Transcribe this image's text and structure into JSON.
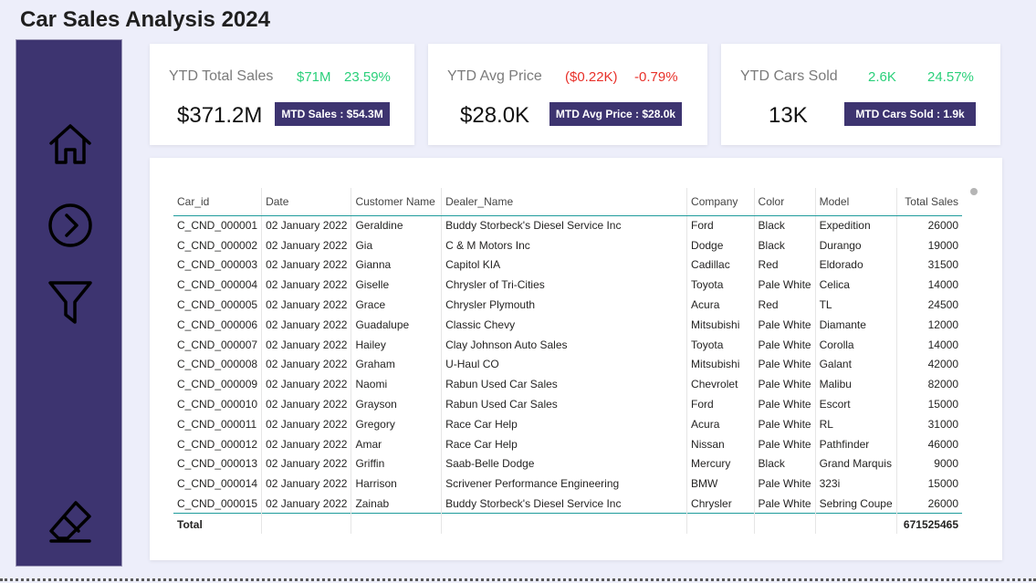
{
  "page": {
    "title": "Car Sales Analysis 2024"
  },
  "sidebar": {
    "icons": [
      "home-icon",
      "chevron-right-circle-icon",
      "filter-icon",
      "eraser-icon"
    ]
  },
  "kpis": [
    {
      "label": "YTD Total Sales",
      "delta1": "$71M",
      "delta2": "23.59%",
      "value": "$371.2M",
      "badge": "MTD Sales : $54.3M",
      "delta_color": "#2ad07a"
    },
    {
      "label": "YTD Avg Price",
      "delta1": "($0.22K)",
      "delta2": "-0.79%",
      "value": "$28.0K",
      "badge": "MTD Avg Price : $28.0k",
      "delta_color": "#e8312a"
    },
    {
      "label": "YTD Cars Sold",
      "delta1": "2.6K",
      "delta2": "24.57%",
      "value": "13K",
      "badge": "MTD Cars Sold : 1.9k",
      "delta_color": "#2ad07a"
    }
  ],
  "table": {
    "columns": [
      "Car_id",
      "Date",
      "Customer Name",
      "Dealer_Name",
      "Company",
      "Color",
      "Model",
      "Total Sales"
    ],
    "rows": [
      [
        "C_CND_000001",
        "02 January 2022",
        "Geraldine",
        "Buddy Storbeck's Diesel Service Inc",
        "Ford",
        "Black",
        "Expedition",
        "26000"
      ],
      [
        "C_CND_000002",
        "02 January 2022",
        "Gia",
        "C & M Motors Inc",
        "Dodge",
        "Black",
        "Durango",
        "19000"
      ],
      [
        "C_CND_000003",
        "02 January 2022",
        "Gianna",
        "Capitol KIA",
        "Cadillac",
        "Red",
        "Eldorado",
        "31500"
      ],
      [
        "C_CND_000004",
        "02 January 2022",
        "Giselle",
        "Chrysler of Tri-Cities",
        "Toyota",
        "Pale White",
        "Celica",
        "14000"
      ],
      [
        "C_CND_000005",
        "02 January 2022",
        "Grace",
        "Chrysler Plymouth",
        "Acura",
        "Red",
        "TL",
        "24500"
      ],
      [
        "C_CND_000006",
        "02 January 2022",
        "Guadalupe",
        "Classic Chevy",
        "Mitsubishi",
        "Pale White",
        "Diamante",
        "12000"
      ],
      [
        "C_CND_000007",
        "02 January 2022",
        "Hailey",
        "Clay Johnson Auto Sales",
        "Toyota",
        "Pale White",
        "Corolla",
        "14000"
      ],
      [
        "C_CND_000008",
        "02 January 2022",
        "Graham",
        "U-Haul CO",
        "Mitsubishi",
        "Pale White",
        "Galant",
        "42000"
      ],
      [
        "C_CND_000009",
        "02 January 2022",
        "Naomi",
        "Rabun Used Car Sales",
        "Chevrolet",
        "Pale White",
        "Malibu",
        "82000"
      ],
      [
        "C_CND_000010",
        "02 January 2022",
        "Grayson",
        "Rabun Used Car Sales",
        "Ford",
        "Pale White",
        "Escort",
        "15000"
      ],
      [
        "C_CND_000011",
        "02 January 2022",
        "Gregory",
        "Race Car Help",
        "Acura",
        "Pale White",
        "RL",
        "31000"
      ],
      [
        "C_CND_000012",
        "02 January 2022",
        "Amar",
        "Race Car Help",
        "Nissan",
        "Pale White",
        "Pathfinder",
        "46000"
      ],
      [
        "C_CND_000013",
        "02 January 2022",
        "Griffin",
        "Saab-Belle Dodge",
        "Mercury",
        "Black",
        "Grand Marquis",
        "9000"
      ],
      [
        "C_CND_000014",
        "02 January 2022",
        "Harrison",
        "Scrivener Performance Engineering",
        "BMW",
        "Pale White",
        "323i",
        "15000"
      ],
      [
        "C_CND_000015",
        "02 January 2022",
        "Zainab",
        "Buddy Storbeck's Diesel Service Inc",
        "Chrysler",
        "Pale White",
        "Sebring Coupe",
        "26000"
      ]
    ],
    "total_label": "Total",
    "total_value": "671525465"
  }
}
